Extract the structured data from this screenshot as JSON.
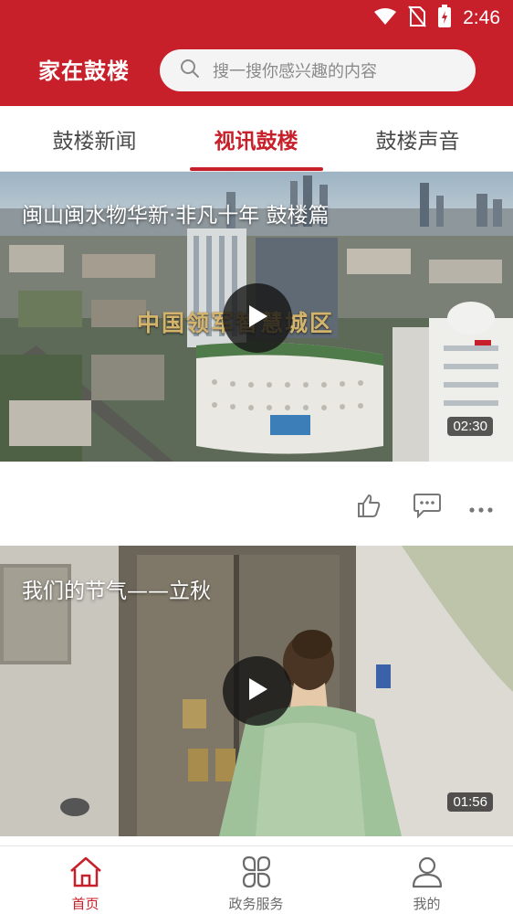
{
  "status": {
    "time": "2:46"
  },
  "header": {
    "app_title": "家在鼓楼",
    "search_placeholder": "搜一搜你感兴趣的内容"
  },
  "tabs": [
    {
      "label": "鼓楼新闻",
      "active": false
    },
    {
      "label": "视讯鼓楼",
      "active": true
    },
    {
      "label": "鼓楼声音",
      "active": false
    }
  ],
  "videos": [
    {
      "title": "闽山闽水物华新·非凡十年 鼓楼篇",
      "duration": "02:30",
      "overlay_text": "中国领军智慧城区"
    },
    {
      "title": "我们的节气——立秋",
      "duration": "01:56"
    }
  ],
  "bottom_nav": [
    {
      "label": "首页",
      "icon": "home-icon",
      "active": true
    },
    {
      "label": "政务服务",
      "icon": "grid-icon",
      "active": false
    },
    {
      "label": "我的",
      "icon": "user-icon",
      "active": false
    }
  ],
  "colors": {
    "brand": "#c8202a",
    "tab_inactive": "#4a4a4a",
    "nav_inactive": "#6b6b6b"
  }
}
